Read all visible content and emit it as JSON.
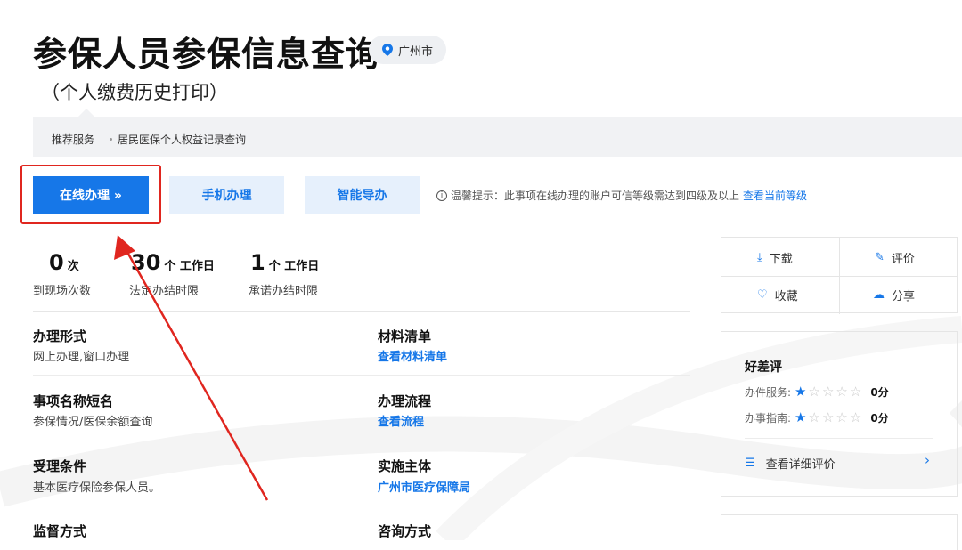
{
  "header": {
    "title": "参保人员参保信息查询",
    "location": "广州市",
    "subtitle": "（个人缴费历史打印）"
  },
  "recommend": {
    "label": "推荐服务",
    "item": "居民医保个人权益记录查询"
  },
  "actions": {
    "online": "在线办理 »",
    "mobile": "手机办理",
    "guide": "智能导办"
  },
  "tip": {
    "text": "温馨提示：此事项在线办理的账户可信等级需达到四级及以上",
    "link": "查看当前等级"
  },
  "stats": [
    {
      "num": "0",
      "unit": "次",
      "label": "到现场次数"
    },
    {
      "num": "30",
      "unit": "个 工作日",
      "label": "法定办结时限"
    },
    {
      "num": "1",
      "unit": "个 工作日",
      "label": "承诺办结时限"
    }
  ],
  "info": {
    "form_label": "办理形式",
    "form_value": "网上办理,窗口办理",
    "materials_label": "材料清单",
    "materials_link": "查看材料清单",
    "short_name_label": "事项名称短名",
    "short_name_value": "参保情况/医保余额查询",
    "process_label": "办理流程",
    "process_link": "查看流程",
    "conditions_label": "受理条件",
    "conditions_value": "基本医疗保险参保人员。",
    "subject_label": "实施主体",
    "subject_link": "广州市医疗保障局",
    "supervision_label": "监督方式",
    "consult_label": "咨询方式"
  },
  "side_actions": {
    "download": "下载",
    "rate": "评价",
    "favorite": "收藏",
    "share": "分享"
  },
  "evaluation": {
    "title": "好差评",
    "service_label": "办件服务:",
    "service_stars": 1,
    "service_score": "0分",
    "guide_label": "办事指南:",
    "guide_stars": 1,
    "guide_score": "0分",
    "more": "查看详细评价"
  },
  "colors": {
    "accent": "#1677e8",
    "highlight": "#e0261f"
  }
}
